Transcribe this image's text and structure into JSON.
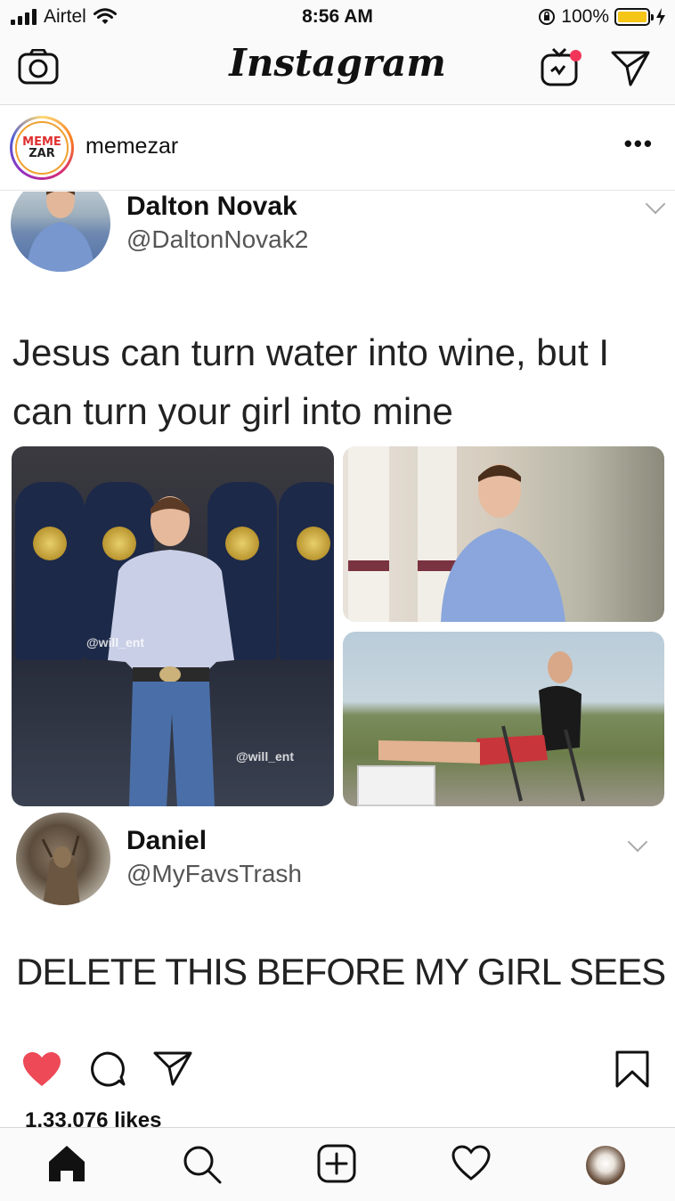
{
  "status_bar": {
    "carrier": "Airtel",
    "time": "8:56 AM",
    "battery_percent": "100%",
    "battery_level": 1.0,
    "battery_color": "#f5c518"
  },
  "header": {
    "title": "Instagram",
    "icons": [
      "camera-icon",
      "igtv-icon",
      "direct-message-icon"
    ],
    "notification_dot_color": "#f2365a"
  },
  "post": {
    "username": "memezar",
    "avatar_text_top": "MEME",
    "avatar_text_bottom": "ZAR",
    "more_label": "•••",
    "likes_text": "1,33,076 likes",
    "liked": true,
    "like_color": "#ed4956"
  },
  "tweet": {
    "author_name": "Dalton Novak",
    "author_handle": "@DaltonNovak2",
    "text": "Jesus can turn water into wine, but I can turn your girl into mine",
    "photo_watermark_1": "@will_ent",
    "photo_watermark_2": "@will_ent",
    "reply_name": "Daniel",
    "reply_handle": "@MyFavsTrash",
    "reply_text": "DELETE THIS BEFORE MY GIRL SEES"
  },
  "tab_bar": {
    "items": [
      "home-icon",
      "search-icon",
      "new-post-icon",
      "activity-heart-icon",
      "profile-avatar"
    ]
  }
}
